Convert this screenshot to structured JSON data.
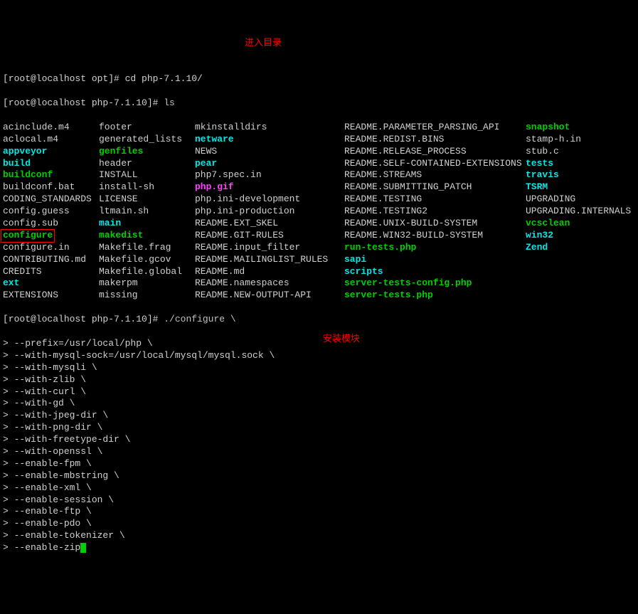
{
  "annotations": {
    "enter_dir": "进入目录",
    "install_module": "安装模块"
  },
  "prompts": {
    "line1": "[root@localhost opt]# cd php-7.1.10/",
    "line2_prompt": "[root@localhost php-7.1.10]# ",
    "line2_cmd": "ls",
    "line_conf_prompt": "[root@localhost php-7.1.10]# ",
    "line_conf_cmd": "./configure \\"
  },
  "ls": {
    "rows": [
      [
        {
          "t": "acinclude.m4",
          "c": "white"
        },
        {
          "t": "footer",
          "c": "white"
        },
        {
          "t": "mkinstalldirs",
          "c": "white"
        },
        {
          "t": "README.PARAMETER_PARSING_API",
          "c": "white"
        },
        {
          "t": "snapshot",
          "c": "green"
        }
      ],
      [
        {
          "t": "aclocal.m4",
          "c": "white"
        },
        {
          "t": "generated_lists",
          "c": "white"
        },
        {
          "t": "netware",
          "c": "cyan"
        },
        {
          "t": "README.REDIST.BINS",
          "c": "white"
        },
        {
          "t": "stamp-h.in",
          "c": "white"
        }
      ],
      [
        {
          "t": "appveyor",
          "c": "cyan"
        },
        {
          "t": "genfiles",
          "c": "green"
        },
        {
          "t": "NEWS",
          "c": "white"
        },
        {
          "t": "README.RELEASE_PROCESS",
          "c": "white"
        },
        {
          "t": "stub.c",
          "c": "white"
        }
      ],
      [
        {
          "t": "build",
          "c": "cyan"
        },
        {
          "t": "header",
          "c": "white"
        },
        {
          "t": "pear",
          "c": "cyan"
        },
        {
          "t": "README.SELF-CONTAINED-EXTENSIONS",
          "c": "white"
        },
        {
          "t": "tests",
          "c": "cyan"
        }
      ],
      [
        {
          "t": "buildconf",
          "c": "green"
        },
        {
          "t": "INSTALL",
          "c": "white"
        },
        {
          "t": "php7.spec.in",
          "c": "white"
        },
        {
          "t": "README.STREAMS",
          "c": "white"
        },
        {
          "t": "travis",
          "c": "cyan"
        }
      ],
      [
        {
          "t": "buildconf.bat",
          "c": "white"
        },
        {
          "t": "install-sh",
          "c": "white"
        },
        {
          "t": "php.gif",
          "c": "magenta"
        },
        {
          "t": "README.SUBMITTING_PATCH",
          "c": "white"
        },
        {
          "t": "TSRM",
          "c": "cyan"
        }
      ],
      [
        {
          "t": "CODING_STANDARDS",
          "c": "white"
        },
        {
          "t": "LICENSE",
          "c": "white"
        },
        {
          "t": "php.ini-development",
          "c": "white"
        },
        {
          "t": "README.TESTING",
          "c": "white"
        },
        {
          "t": "UPGRADING",
          "c": "white"
        }
      ],
      [
        {
          "t": "config.guess",
          "c": "white"
        },
        {
          "t": "ltmain.sh",
          "c": "white"
        },
        {
          "t": "php.ini-production",
          "c": "white"
        },
        {
          "t": "README.TESTING2",
          "c": "white"
        },
        {
          "t": "UPGRADING.INTERNALS",
          "c": "white"
        }
      ],
      [
        {
          "t": "config.sub",
          "c": "white"
        },
        {
          "t": "main",
          "c": "cyan"
        },
        {
          "t": "README.EXT_SKEL",
          "c": "white"
        },
        {
          "t": "README.UNIX-BUILD-SYSTEM",
          "c": "white"
        },
        {
          "t": "vcsclean",
          "c": "green"
        }
      ],
      [
        {
          "t": "configure",
          "c": "green",
          "boxed": true
        },
        {
          "t": "makedist",
          "c": "green"
        },
        {
          "t": "README.GIT-RULES",
          "c": "white"
        },
        {
          "t": "README.WIN32-BUILD-SYSTEM",
          "c": "white"
        },
        {
          "t": "win32",
          "c": "cyan"
        }
      ],
      [
        {
          "t": "configure.in",
          "c": "white"
        },
        {
          "t": "Makefile.frag",
          "c": "white"
        },
        {
          "t": "README.input_filter",
          "c": "white"
        },
        {
          "t": "run-tests.php",
          "c": "green"
        },
        {
          "t": "Zend",
          "c": "cyan"
        }
      ],
      [
        {
          "t": "CONTRIBUTING.md",
          "c": "white"
        },
        {
          "t": "Makefile.gcov",
          "c": "white"
        },
        {
          "t": "README.MAILINGLIST_RULES",
          "c": "white"
        },
        {
          "t": "sapi",
          "c": "cyan"
        },
        {
          "t": "",
          "c": "white"
        }
      ],
      [
        {
          "t": "CREDITS",
          "c": "white"
        },
        {
          "t": "Makefile.global",
          "c": "white"
        },
        {
          "t": "README.md",
          "c": "white"
        },
        {
          "t": "scripts",
          "c": "cyan"
        },
        {
          "t": "",
          "c": "white"
        }
      ],
      [
        {
          "t": "ext",
          "c": "cyan"
        },
        {
          "t": "makerpm",
          "c": "white"
        },
        {
          "t": "README.namespaces",
          "c": "white"
        },
        {
          "t": "server-tests-config.php",
          "c": "green"
        },
        {
          "t": "",
          "c": "white"
        }
      ],
      [
        {
          "t": "EXTENSIONS",
          "c": "white"
        },
        {
          "t": "missing",
          "c": "white"
        },
        {
          "t": "README.NEW-OUTPUT-API",
          "c": "white"
        },
        {
          "t": "server-tests.php",
          "c": "green"
        },
        {
          "t": "",
          "c": "white"
        }
      ]
    ]
  },
  "configure_lines": [
    "> --prefix=/usr/local/php \\",
    "> --with-mysql-sock=/usr/local/mysql/mysql.sock \\",
    "> --with-mysqli \\",
    "> --with-zlib \\",
    "> --with-curl \\",
    "> --with-gd \\",
    "> --with-jpeg-dir \\",
    "> --with-png-dir \\",
    "> --with-freetype-dir \\",
    "> --with-openssl \\",
    "> --enable-fpm \\",
    "> --enable-mbstring \\",
    "> --enable-xml \\",
    "> --enable-session \\",
    "> --enable-ftp \\",
    "> --enable-pdo \\",
    "> --enable-tokenizer \\",
    "> --enable-zip"
  ]
}
